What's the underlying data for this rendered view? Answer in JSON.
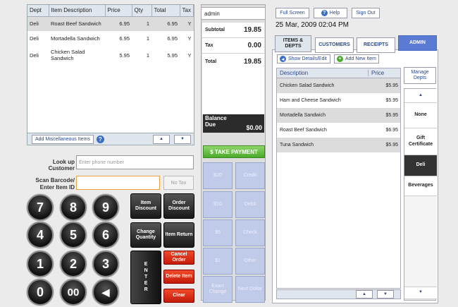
{
  "cart": {
    "columns": [
      "Dept",
      "Item Description",
      "Price",
      "Qty",
      "Total",
      "Tax"
    ],
    "rows": [
      {
        "dept": "Deli",
        "desc": "Roast Beef Sandwich",
        "price": "6.95",
        "qty": "1",
        "total": "6.95",
        "tax": "Y"
      },
      {
        "dept": "Deli",
        "desc": "Mortadella Sandwich",
        "price": "6.95",
        "qty": "1",
        "total": "6.95",
        "tax": "Y"
      },
      {
        "dept": "Deli",
        "desc": "Chicken Salad Sandwich",
        "price": "5.95",
        "qty": "1",
        "total": "5.95",
        "tax": "Y"
      }
    ],
    "misc_button": "Add Miscellaneous Items",
    "help": "?",
    "up": "▲",
    "down": "▼"
  },
  "lookup": {
    "label": "Look up Customer",
    "placeholder": "Enter phone number"
  },
  "scan": {
    "label_line1": "Scan Barcode/",
    "label_line2": "Enter Item ID",
    "value": "",
    "no_tax": "No Tax"
  },
  "keypad": {
    "k7": "7",
    "k8": "8",
    "k9": "9",
    "k4": "4",
    "k5": "5",
    "k6": "6",
    "k1": "1",
    "k2": "2",
    "k3": "3",
    "k0": "0",
    "k00": "00",
    "back": "◀"
  },
  "functions": {
    "item_discount": "Item Discount",
    "order_discount": "Order Discount",
    "change_quantity": "Change Quantity",
    "item_return": "Item Return",
    "enter": "ENTER",
    "cancel_order": "Cancel Order",
    "delete_item": "Delete Item",
    "clear": "Clear"
  },
  "totals": {
    "user": "admin",
    "subtotal_label": "Subtotal",
    "subtotal": "19.85",
    "tax_label": "Tax",
    "tax": "0.00",
    "total_label": "Total",
    "total": "19.85",
    "balance_label1": "Balance",
    "balance_label2": "Due",
    "balance": "$0.00"
  },
  "payment": {
    "take_payment": "$ TAKE PAYMENT",
    "keys": [
      [
        "$20",
        "Credit"
      ],
      [
        "$10",
        "Debit"
      ],
      [
        "$5",
        "Check"
      ],
      [
        "$1",
        "Other"
      ],
      [
        "Exact Change",
        "Next Dollar"
      ]
    ]
  },
  "top_buttons": {
    "full_screen": "Full Screen",
    "help": "Help",
    "sign_out": "Sign Out"
  },
  "datetime": "25 Mar, 2009 02:04 PM",
  "tabs": {
    "items_depts": "ITEMS & DEPTS",
    "customers": "CUSTOMERS",
    "receipts": "RECEIPTS",
    "admin": "ADMIN"
  },
  "item_actions": {
    "show_details": "Show Details/Edit",
    "add_new": "Add New Item"
  },
  "items": {
    "columns": [
      "Description",
      "Price"
    ],
    "rows": [
      {
        "desc": "Chicken Salad Sandwich",
        "price": "$5.95"
      },
      {
        "desc": "Ham and Cheese Sandwich",
        "price": "$5.95"
      },
      {
        "desc": "Mortadella Sandwich",
        "price": "$5.95"
      },
      {
        "desc": "Roast Beef Sandwich",
        "price": "$6.95"
      },
      {
        "desc": "Tuna Sandwich",
        "price": "$5.95"
      }
    ],
    "up": "▲",
    "down": "▼"
  },
  "departments": {
    "manage": "Manage Depts",
    "items": [
      "None",
      "Gift Certificate",
      "Deli",
      "Beverages"
    ],
    "selected": "Deli",
    "up": "▲",
    "down": "▼"
  },
  "colors": {
    "accent": "#5a7ad4",
    "pay_green": "#4aaa2a",
    "red": "#c41a0a"
  }
}
